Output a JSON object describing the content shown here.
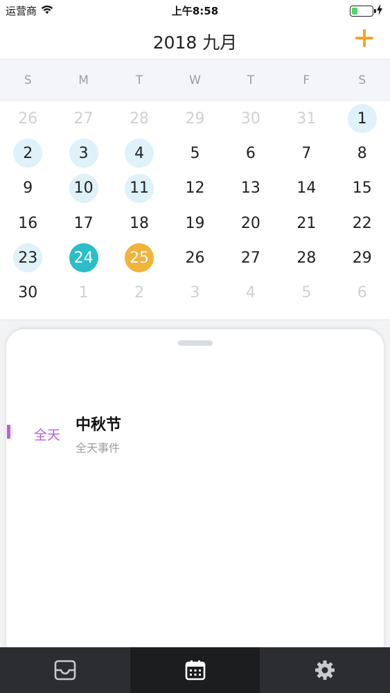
{
  "status_bar": {
    "carrier": "运营商",
    "time": "上午8:58",
    "wifi_icon": "wifi-icon",
    "battery_icon": "battery-icon",
    "charging_icon": "charging-bolt-icon",
    "battery_level": 0.3
  },
  "header": {
    "title": "2018 九月",
    "add_icon": "plus-icon"
  },
  "weekdays": [
    "S",
    "M",
    "T",
    "W",
    "T",
    "F",
    "S"
  ],
  "calendar": {
    "weeks": [
      [
        {
          "d": "26",
          "type": "other"
        },
        {
          "d": "27",
          "type": "other"
        },
        {
          "d": "28",
          "type": "other"
        },
        {
          "d": "29",
          "type": "other"
        },
        {
          "d": "30",
          "type": "other"
        },
        {
          "d": "31",
          "type": "other"
        },
        {
          "d": "1",
          "type": "event"
        }
      ],
      [
        {
          "d": "2",
          "type": "event"
        },
        {
          "d": "3",
          "type": "event"
        },
        {
          "d": "4",
          "type": "event"
        },
        {
          "d": "5",
          "type": "normal"
        },
        {
          "d": "6",
          "type": "normal"
        },
        {
          "d": "7",
          "type": "normal"
        },
        {
          "d": "8",
          "type": "normal"
        }
      ],
      [
        {
          "d": "9",
          "type": "normal"
        },
        {
          "d": "10",
          "type": "event"
        },
        {
          "d": "11",
          "type": "event"
        },
        {
          "d": "12",
          "type": "normal"
        },
        {
          "d": "13",
          "type": "normal"
        },
        {
          "d": "14",
          "type": "normal"
        },
        {
          "d": "15",
          "type": "normal"
        }
      ],
      [
        {
          "d": "16",
          "type": "normal"
        },
        {
          "d": "17",
          "type": "normal"
        },
        {
          "d": "18",
          "type": "normal"
        },
        {
          "d": "19",
          "type": "normal"
        },
        {
          "d": "20",
          "type": "normal"
        },
        {
          "d": "21",
          "type": "normal"
        },
        {
          "d": "22",
          "type": "normal"
        }
      ],
      [
        {
          "d": "23",
          "type": "event"
        },
        {
          "d": "24",
          "type": "today"
        },
        {
          "d": "25",
          "type": "selected"
        },
        {
          "d": "26",
          "type": "normal"
        },
        {
          "d": "27",
          "type": "normal"
        },
        {
          "d": "28",
          "type": "normal"
        },
        {
          "d": "29",
          "type": "normal"
        }
      ],
      [
        {
          "d": "30",
          "type": "normal"
        },
        {
          "d": "1",
          "type": "other"
        },
        {
          "d": "2",
          "type": "other"
        },
        {
          "d": "3",
          "type": "other"
        },
        {
          "d": "4",
          "type": "other"
        },
        {
          "d": "5",
          "type": "other"
        },
        {
          "d": "6",
          "type": "other"
        }
      ]
    ]
  },
  "events": [
    {
      "time": "全天",
      "title": "中秋节",
      "subtitle": "全天事件",
      "color": "#c25bd9"
    }
  ],
  "tabbar": {
    "tabs": [
      {
        "icon": "inbox-icon",
        "active": false
      },
      {
        "icon": "calendar-icon",
        "active": true
      },
      {
        "icon": "gear-icon",
        "active": false
      }
    ]
  },
  "colors": {
    "accent_orange": "#f2b33d",
    "today_teal": "#2bbdc8",
    "event_day_bg": "#dff1f9",
    "event_purple": "#c25bd9",
    "tabbar_bg": "#2b2d30"
  }
}
